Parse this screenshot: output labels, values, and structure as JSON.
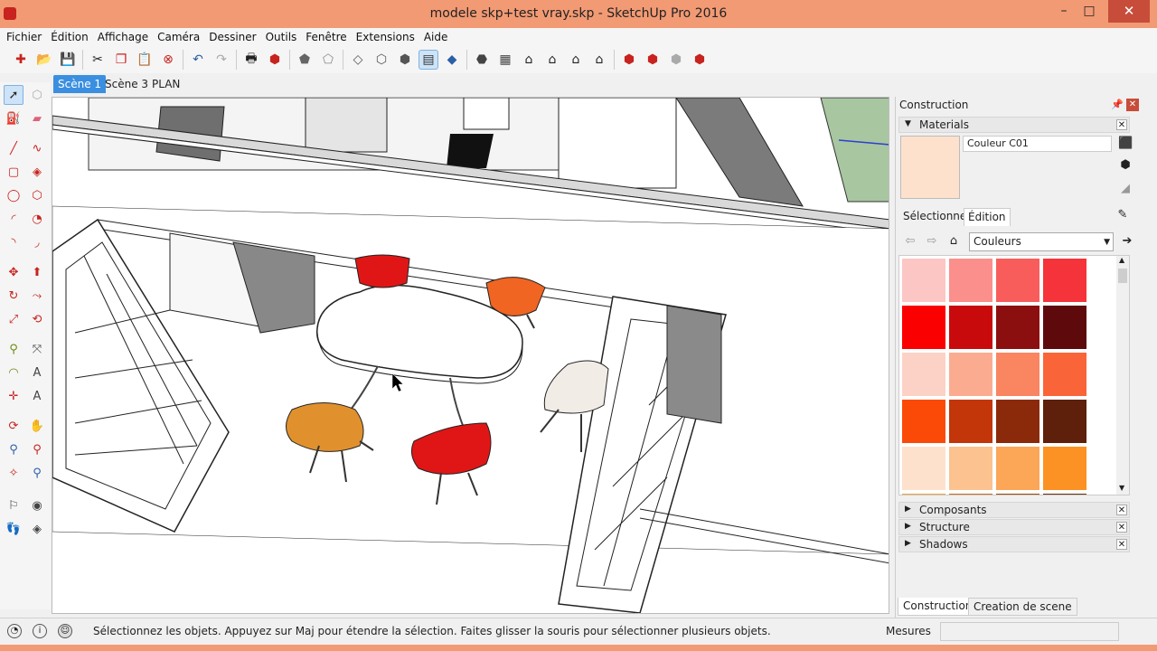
{
  "window": {
    "title": "modele skp+test vray.skp - SketchUp Pro 2016",
    "controls": {
      "minimize": "–",
      "maximize": "□",
      "close": "✕"
    }
  },
  "menu": {
    "items": [
      "Fichier",
      "Édition",
      "Affichage",
      "Caméra",
      "Dessiner",
      "Outils",
      "Fenêtre",
      "Extensions",
      "Aide"
    ]
  },
  "toolbar": {
    "icons": [
      "new-icon",
      "open-icon",
      "save-icon",
      "cut-icon",
      "copy-icon",
      "paste-icon",
      "erase-icon",
      "undo-icon",
      "redo-icon",
      "print-icon",
      "model-info-icon",
      "xray-icon",
      "back-edges-icon",
      "wireframe-icon",
      "hidden-line-icon",
      "shaded-icon",
      "shaded-textures-icon",
      "monochrome-icon",
      "iso-icon",
      "top-icon",
      "front-icon",
      "right-icon",
      "back-icon",
      "left-icon",
      "warehouse-icon",
      "share-model-icon",
      "share-component-icon",
      "extension-warehouse-icon"
    ]
  },
  "scenes": {
    "tabs": [
      "Scène 1",
      "Scène 3",
      "PLAN"
    ],
    "active_index": 0
  },
  "palette": {
    "tools": [
      "select-icon",
      "make-component-icon",
      "paint-bucket-icon",
      "eraser-icon",
      "line-icon",
      "freehand-icon",
      "rectangle-icon",
      "rotated-rectangle-icon",
      "circle-icon",
      "polygon-icon",
      "arc-icon",
      "pie-icon",
      "two-point-arc-icon",
      "three-point-arc-icon",
      "move-icon",
      "push-pull-icon",
      "rotate-icon",
      "follow-me-icon",
      "scale-icon",
      "offset-icon",
      "tape-measure-icon",
      "dimension-icon",
      "protractor-icon",
      "text-icon",
      "axes-icon",
      "3d-text-icon",
      "orbit-icon",
      "pan-icon",
      "zoom-icon",
      "zoom-window-icon",
      "zoom-extents-icon",
      "previous-view-icon",
      "position-camera-icon",
      "look-around-icon",
      "walk-icon",
      "section-plane-icon"
    ]
  },
  "tray": {
    "title": "Construction",
    "materials": {
      "label": "Materials",
      "current_name": "Couleur C01",
      "current_color": "#fde1cd",
      "tabs": [
        "Sélectionner",
        "Édition"
      ],
      "collection": "Couleurs",
      "swatches": [
        "#fcc6c4",
        "#fb8f8c",
        "#f85d5c",
        "#f5333a",
        "#fa0000",
        "#c90a0c",
        "#8c0f10",
        "#5e0a0c",
        "#fdd2c6",
        "#fbac90",
        "#f98561",
        "#f96538",
        "#fb4a08",
        "#c2360a",
        "#8b2a0b",
        "#5e1f0b",
        "#fde1cd",
        "#fcc290",
        "#fca658",
        "#fb9223",
        "#f2a23d",
        "#d06a16",
        "#a24807",
        "#6a300b"
      ]
    },
    "sections": [
      "Composants",
      "Structure",
      "Shadows"
    ],
    "bottom_tabs": [
      "Construction",
      "Creation de scene"
    ]
  },
  "status": {
    "message": "Sélectionnez les objets. Appuyez sur Maj pour étendre la sélection. Faites glisser la souris pour sélectionner plusieurs objets.",
    "measures_label": "Mesures",
    "measures_value": ""
  },
  "colors": {
    "titlebar": "#f29a74",
    "close_button": "#c74d3a",
    "active_tab": "#3b8fe0",
    "chair_red": "#e01616",
    "chair_orange": "#e0912e",
    "chair_white": "#f2ece6"
  }
}
